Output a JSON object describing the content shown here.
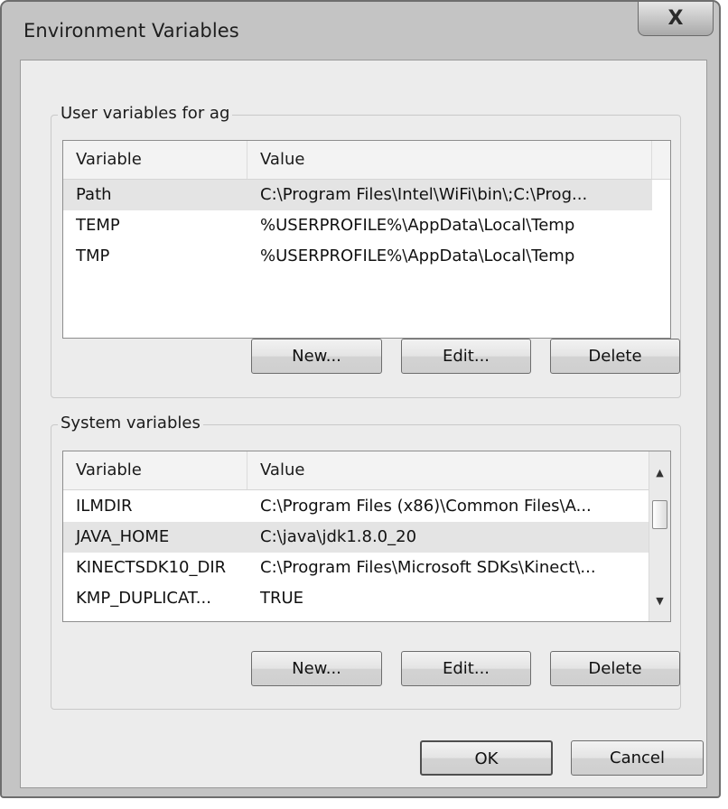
{
  "window": {
    "title": "Environment Variables",
    "close_glyph": "X"
  },
  "user_vars": {
    "group_label": "User variables for ag",
    "headers": {
      "variable": "Variable",
      "value": "Value"
    },
    "rows": [
      {
        "variable": "Path",
        "value": "C:\\Program Files\\Intel\\WiFi\\bin\\;C:\\Prog..."
      },
      {
        "variable": "TEMP",
        "value": "%USERPROFILE%\\AppData\\Local\\Temp"
      },
      {
        "variable": "TMP",
        "value": "%USERPROFILE%\\AppData\\Local\\Temp"
      }
    ],
    "buttons": {
      "new": "New...",
      "edit": "Edit...",
      "delete": "Delete"
    }
  },
  "system_vars": {
    "group_label": "System variables",
    "headers": {
      "variable": "Variable",
      "value": "Value"
    },
    "rows": [
      {
        "variable": "ILMDIR",
        "value": "C:\\Program Files (x86)\\Common Files\\A..."
      },
      {
        "variable": "JAVA_HOME",
        "value": "C:\\java\\jdk1.8.0_20"
      },
      {
        "variable": "KINECTSDK10_DIR",
        "value": "C:\\Program Files\\Microsoft SDKs\\Kinect\\..."
      },
      {
        "variable": "KMP_DUPLICAT...",
        "value": "TRUE"
      }
    ],
    "buttons": {
      "new": "New...",
      "edit": "Edit...",
      "delete": "Delete"
    }
  },
  "dialog_buttons": {
    "ok": "OK",
    "cancel": "Cancel"
  },
  "icons": {
    "close": "close-icon",
    "scroll_up": "scroll-up-arrow-icon",
    "scroll_down": "scroll-down-arrow-icon"
  }
}
